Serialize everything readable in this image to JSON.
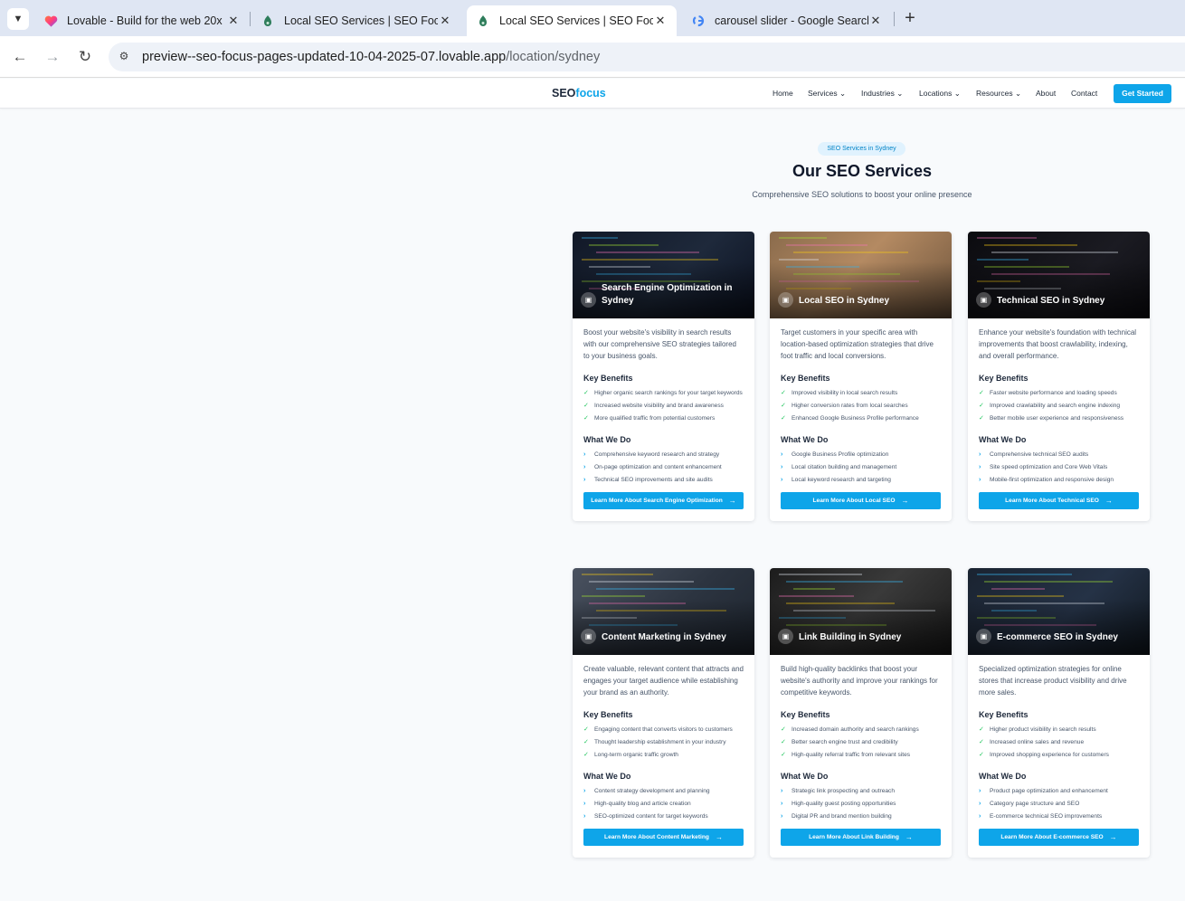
{
  "browser": {
    "tabs": [
      {
        "title": "Lovable - Build for the web 20x",
        "favicon": "heart-favicon",
        "active": false
      },
      {
        "title": "Local SEO Services | SEO Focus",
        "favicon": "lovable-doc-favicon",
        "active": false
      },
      {
        "title": "Local SEO Services | SEO Focus",
        "favicon": "lovable-doc-favicon",
        "active": true
      },
      {
        "title": "carousel slider - Google Search",
        "favicon": "google-g-favicon",
        "active": false
      }
    ],
    "url_host": "preview--seo-focus-pages-updated-10-04-2025-07.lovable.app",
    "url_path": "/location/sydney"
  },
  "site": {
    "logo_main": "SEO",
    "logo_accent": "focus",
    "nav": [
      "Home",
      "Services",
      "Industries",
      "Locations",
      "Resources",
      "About",
      "Contact"
    ],
    "cta": "Get Started"
  },
  "section": {
    "pill": "SEO Services in Sydney",
    "title": "Our SEO Services",
    "subtitle": "Comprehensive SEO solutions to boost your online presence"
  },
  "labels": {
    "benefits": "Key Benefits",
    "what": "What We Do"
  },
  "cards": [
    {
      "title": "Search Engine Optimization in Sydney",
      "desc": "Boost your website's visibility in search results with our comprehensive SEO strategies tailored to your business goals.",
      "benefits": [
        "Higher organic search rankings for your target keywords",
        "Increased website visibility and brand awareness",
        "More qualified traffic from potential customers"
      ],
      "what": [
        "Comprehensive keyword research and strategy",
        "On-page optimization and content enhancement",
        "Technical SEO improvements and site audits"
      ],
      "button": "Learn More About Search Engine Optimization"
    },
    {
      "title": "Local SEO in Sydney",
      "desc": "Target customers in your specific area with location-based optimization strategies that drive foot traffic and local conversions.",
      "benefits": [
        "Improved visibility in local search results",
        "Higher conversion rates from local searches",
        "Enhanced Google Business Profile performance"
      ],
      "what": [
        "Google Business Profile optimization",
        "Local citation building and management",
        "Local keyword research and targeting"
      ],
      "button": "Learn More About Local SEO"
    },
    {
      "title": "Technical SEO in Sydney",
      "desc": "Enhance your website's foundation with technical improvements that boost crawlability, indexing, and overall performance.",
      "benefits": [
        "Faster website performance and loading speeds",
        "Improved crawlability and search engine indexing",
        "Better mobile user experience and responsiveness"
      ],
      "what": [
        "Comprehensive technical SEO audits",
        "Site speed optimization and Core Web Vitals",
        "Mobile-first optimization and responsive design"
      ],
      "button": "Learn More About Technical SEO"
    },
    {
      "title": "Content Marketing in Sydney",
      "desc": "Create valuable, relevant content that attracts and engages your target audience while establishing your brand as an authority.",
      "benefits": [
        "Engaging content that converts visitors to customers",
        "Thought leadership establishment in your industry",
        "Long-term organic traffic growth"
      ],
      "what": [
        "Content strategy development and planning",
        "High-quality blog and article creation",
        "SEO-optimized content for target keywords"
      ],
      "button": "Learn More About Content Marketing"
    },
    {
      "title": "Link Building in Sydney",
      "desc": "Build high-quality backlinks that boost your website's authority and improve your rankings for competitive keywords.",
      "benefits": [
        "Increased domain authority and search rankings",
        "Better search engine trust and credibility",
        "High-quality referral traffic from relevant sites"
      ],
      "what": [
        "Strategic link prospecting and outreach",
        "High-quality guest posting opportunities",
        "Digital PR and brand mention building"
      ],
      "button": "Learn More About Link Building"
    },
    {
      "title": "E-commerce SEO in Sydney",
      "desc": "Specialized optimization strategies for online stores that increase product visibility and drive more sales.",
      "benefits": [
        "Higher product visibility in search results",
        "Increased online sales and revenue",
        "Improved shopping experience for customers"
      ],
      "what": [
        "Product page optimization and enhancement",
        "Category page structure and SEO",
        "E-commerce technical SEO improvements"
      ],
      "button": "Learn More About E-commerce SEO"
    }
  ],
  "colors": {
    "accent": "#0ea5e9",
    "pill_bg": "#e0f2fe",
    "check": "#22c55e",
    "page_bg": "#f8fafc"
  }
}
